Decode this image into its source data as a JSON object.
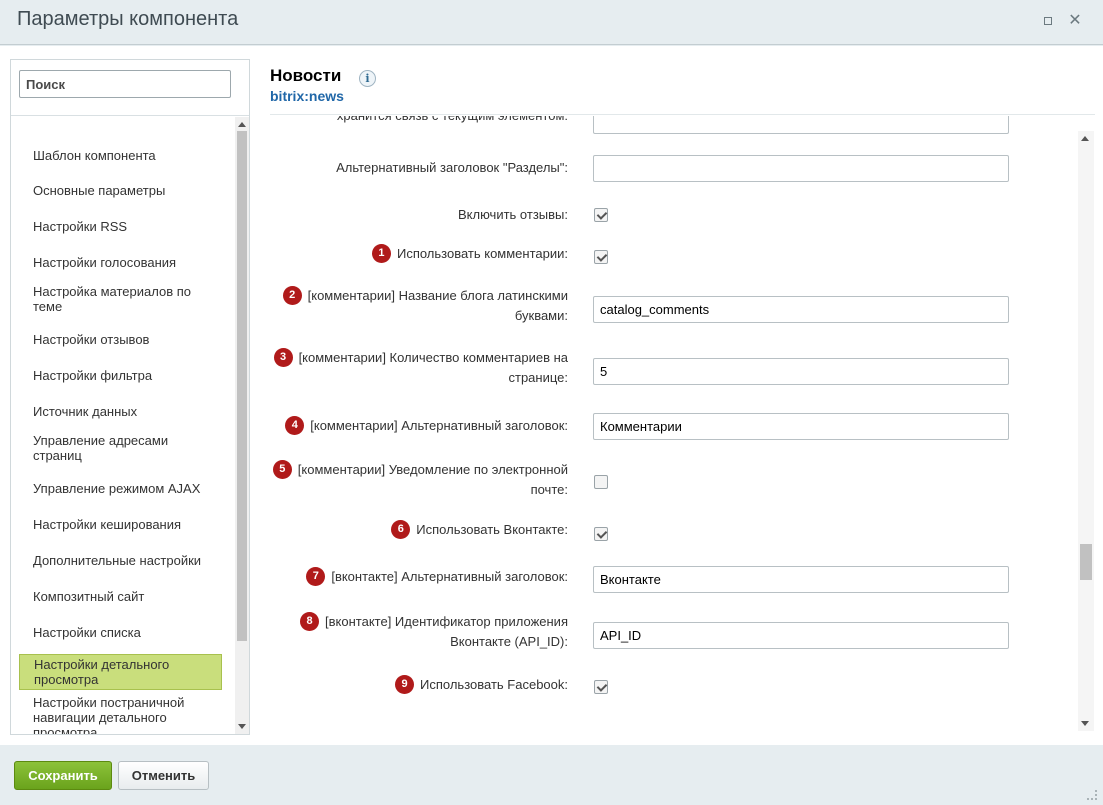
{
  "window": {
    "title": "Параметры компонента",
    "maximize_icon": "maximize-icon",
    "close_icon": "close-icon",
    "close_glyph": "✕"
  },
  "sidebar": {
    "search_placeholder": "Поиск",
    "items": [
      {
        "label": "Шаблон компонента"
      },
      {
        "label": "Основные параметры"
      },
      {
        "label": "Настройки RSS"
      },
      {
        "label": "Настройки голосования"
      },
      {
        "label": "Настройка материалов по теме"
      },
      {
        "label": "Настройки отзывов"
      },
      {
        "label": "Настройки фильтра"
      },
      {
        "label": "Источник данных"
      },
      {
        "label": "Управление адресами страниц"
      },
      {
        "label": "Управление режимом AJAX"
      },
      {
        "label": "Настройки кеширования"
      },
      {
        "label": "Дополнительные настройки"
      },
      {
        "label": "Композитный сайт"
      },
      {
        "label": "Настройки списка"
      },
      {
        "label": "Настройки детального просмотра",
        "active": true
      },
      {
        "label": "Настройки постраничной навигации детального просмотра"
      }
    ]
  },
  "component": {
    "name": "Новости",
    "code": "bitrix:news",
    "info_glyph": "i"
  },
  "params": [
    {
      "label": "хранится связь с текущим элементом:",
      "type": "text",
      "value": ""
    },
    {
      "label": "Альтернативный заголовок \"Разделы\":",
      "type": "text",
      "value": ""
    },
    {
      "label": "Включить отзывы:",
      "type": "checkbox",
      "checked": true
    },
    {
      "badge": "1",
      "label": "Использовать комментарии:",
      "type": "checkbox",
      "checked": true
    },
    {
      "badge": "2",
      "label": "[комментарии] Название блога латинскими буквами:",
      "type": "text",
      "value": "catalog_comments"
    },
    {
      "badge": "3",
      "label": "[комментарии] Количество комментариев на странице:",
      "type": "text",
      "value": "5"
    },
    {
      "badge": "4",
      "label": "[комментарии] Альтернативный заголовок:",
      "type": "text",
      "value": "Комментарии"
    },
    {
      "badge": "5",
      "label": "[комментарии] Уведомление по электронной почте:",
      "type": "checkbox",
      "checked": false
    },
    {
      "badge": "6",
      "label": "Использовать Вконтакте:",
      "type": "checkbox",
      "checked": true
    },
    {
      "badge": "7",
      "label": "[вконтакте] Альтернативный заголовок:",
      "type": "text",
      "value": "Вконтакте"
    },
    {
      "badge": "8",
      "label": "[вконтакте] Идентификатор приложения Вконтакте (API_ID):",
      "type": "text",
      "value": "API_ID"
    },
    {
      "badge": "9",
      "label": "Использовать Facebook:",
      "type": "checkbox",
      "checked": true
    }
  ],
  "footer": {
    "save_label": "Сохранить",
    "cancel_label": "Отменить"
  }
}
